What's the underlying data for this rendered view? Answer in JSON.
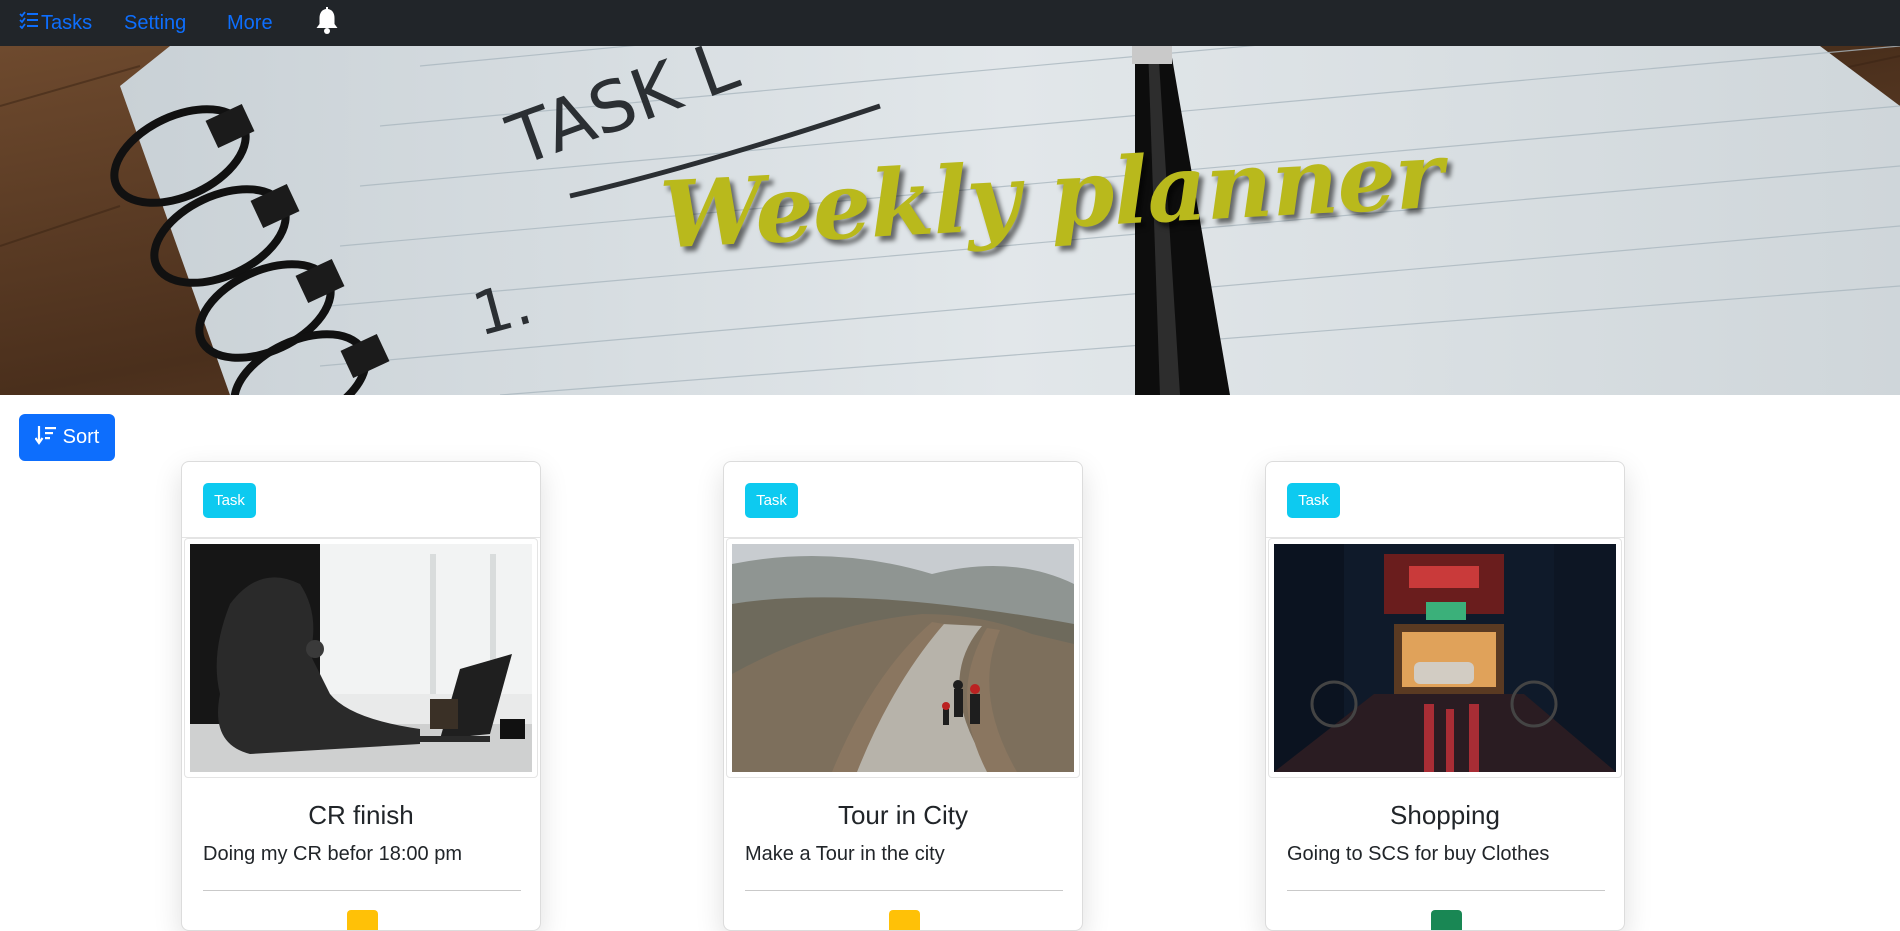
{
  "navbar": {
    "brand_label": "Tasks",
    "brand_icon": "list-check-icon",
    "links": [
      {
        "label": "Setting"
      },
      {
        "label": "More"
      }
    ],
    "bell_icon": "bell-icon"
  },
  "hero": {
    "title": "Weekly planner"
  },
  "sort_button": {
    "label": "Sort",
    "icon": "sort-down-icon"
  },
  "cards": [
    {
      "badge": "Task",
      "title": "CR finish",
      "text": "Doing my CR befor 18:00 pm",
      "status_color": "#ffc107"
    },
    {
      "badge": "Task",
      "title": "Tour in City",
      "text": "Make a Tour in the city",
      "status_color": "#ffc107"
    },
    {
      "badge": "Task",
      "title": "Shopping",
      "text": "Going to SCS for buy Clothes",
      "status_color": "#198754"
    }
  ],
  "colors": {
    "navbar_bg": "#212529",
    "link": "#0d6efd",
    "badge": "#0dcaf0",
    "hero_title": "#b9b91c"
  }
}
